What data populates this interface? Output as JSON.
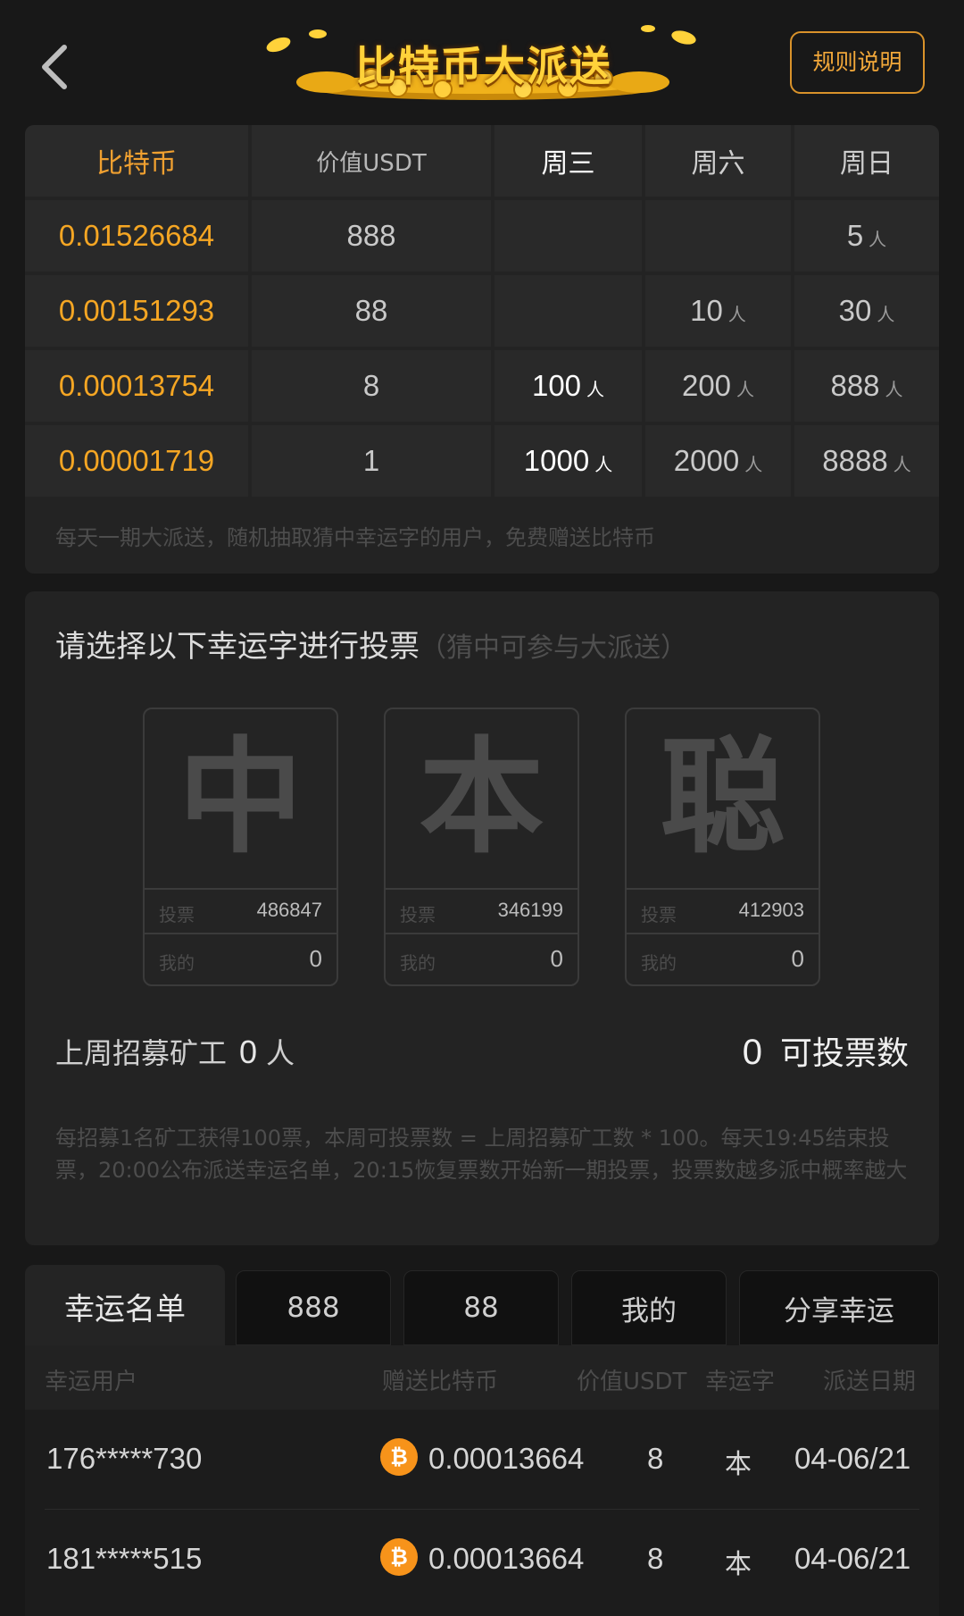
{
  "header": {
    "title": "比特币大派送",
    "rules_label": "规则说明"
  },
  "prize_table": {
    "columns": [
      "比特币",
      "价值USDT",
      "周三",
      "周六",
      "周日"
    ],
    "unit": "人",
    "rows": [
      {
        "btc": "0.01526684",
        "usdt": "888",
        "wed": "",
        "sat": "",
        "sun": "5"
      },
      {
        "btc": "0.00151293",
        "usdt": "88",
        "wed": "",
        "sat": "10",
        "sun": "30"
      },
      {
        "btc": "0.00013754",
        "usdt": "8",
        "wed": "100",
        "sat": "200",
        "sun": "888"
      },
      {
        "btc": "0.00001719",
        "usdt": "1",
        "wed": "1000",
        "sat": "2000",
        "sun": "8888"
      }
    ],
    "note": "每天一期大派送，随机抽取猜中幸运字的用户，免费赠送比特币"
  },
  "vote": {
    "title": "请选择以下幸运字进行投票",
    "subtitle": "（猜中可参与大派送）",
    "vote_label": "投票",
    "mine_label": "我的",
    "options": [
      {
        "char": "中",
        "votes": "486847",
        "mine": "0"
      },
      {
        "char": "本",
        "votes": "346199",
        "mine": "0"
      },
      {
        "char": "聪",
        "votes": "412903",
        "mine": "0"
      }
    ],
    "recruit_label": "上周招募矿工",
    "recruit_count": "0",
    "recruit_unit": "人",
    "votes_available": "0",
    "votes_available_label": "可投票数",
    "note": "每招募1名矿工获得100票，本周可投票数 = 上周招募矿工数 * 100。每天19:45结束投票，20:00公布派送幸运名单，20:15恢复票数开始新一期投票，投票数越多派中概率越大"
  },
  "tabs": [
    "幸运名单",
    "888",
    "88",
    "我的",
    "分享幸运"
  ],
  "winners": {
    "headers": [
      "幸运用户",
      "赠送比特币",
      "价值USDT",
      "幸运字",
      "派送日期"
    ],
    "btc_symbol": "₿",
    "rows": [
      {
        "user": "176*****730",
        "btc": "0.00013664",
        "usdt": "8",
        "char": "本",
        "date": "04-06/21"
      },
      {
        "user": "181*****515",
        "btc": "0.00013664",
        "usdt": "8",
        "char": "本",
        "date": "04-06/21"
      }
    ]
  },
  "colors": {
    "accent": "#f5a623",
    "background": "#181818",
    "card": "#232323"
  }
}
